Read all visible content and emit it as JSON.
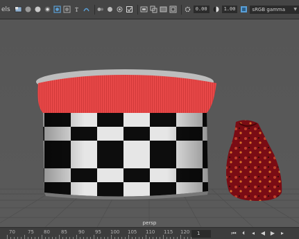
{
  "panel": {
    "menu_label": "els"
  },
  "toolbar": {
    "exposure_value": "0.00",
    "gamma_value": "1.00",
    "color_space": "sRGB gamma"
  },
  "viewport": {
    "camera_label": "persp"
  },
  "timeline": {
    "tick_labels": [
      "70",
      "75",
      "80",
      "85",
      "90",
      "95",
      "100",
      "105",
      "110",
      "115",
      "120"
    ],
    "current_frame": "1"
  },
  "colors": {
    "toolbar_bg": "#454545",
    "viewport_bg": "#595959",
    "checker_dark": "#0d0d0d",
    "checker_light": "#e8e8e8",
    "knit_red": "#e84848",
    "bag_red": "#7a0c14",
    "accent_blue": "#5aa0d8"
  }
}
